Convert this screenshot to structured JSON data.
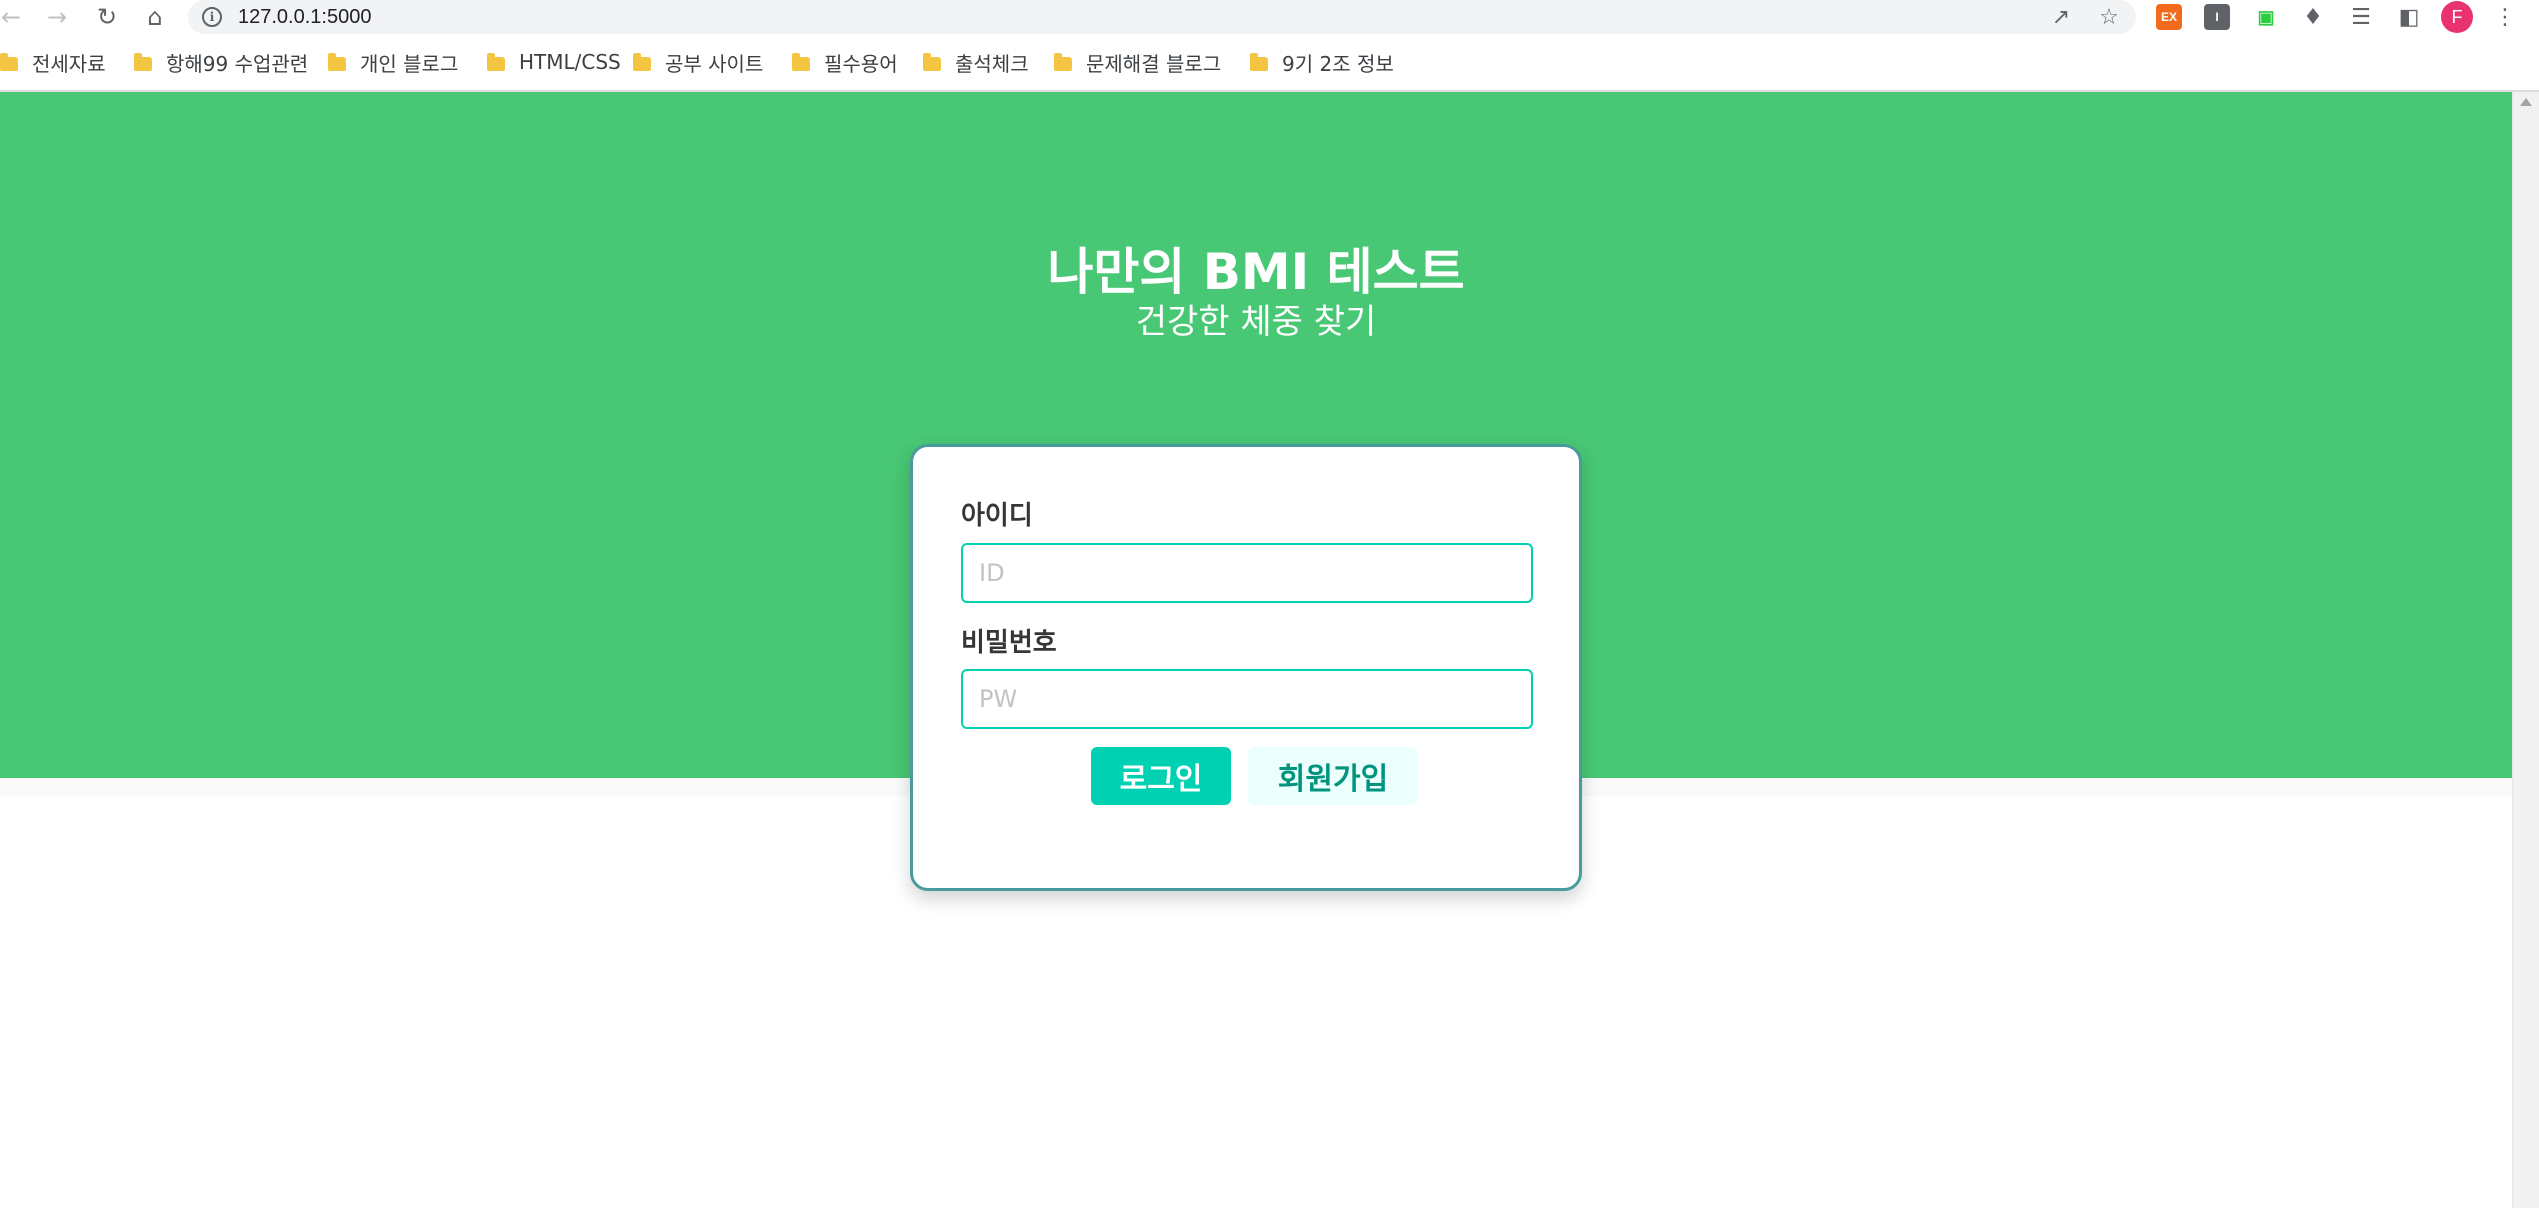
{
  "browser": {
    "url": "127.0.0.1:5000",
    "avatar_letter": "F",
    "extensions": [
      {
        "icon": "ex-extension-icon",
        "text": "EX",
        "color": "#f26b1d"
      },
      {
        "icon": "i-extension-icon",
        "text": "I",
        "color": "#5f6368"
      },
      {
        "icon": "screen-extension-icon",
        "text": "▣",
        "color": "#2ecc40"
      }
    ]
  },
  "bookmarks": [
    {
      "label": "전세자료"
    },
    {
      "label": "항해99 수업관련"
    },
    {
      "label": "개인 블로그"
    },
    {
      "label": "HTML/CSS"
    },
    {
      "label": "공부 사이트"
    },
    {
      "label": "필수용어"
    },
    {
      "label": "출석체크"
    },
    {
      "label": "문제해결 블로그"
    },
    {
      "label": "9기 2조 정보"
    }
  ],
  "hero": {
    "title": "나만의 BMI 테스트",
    "subtitle": "건강한 체중 찾기",
    "color": "#48c774"
  },
  "login": {
    "id_label": "아이디",
    "id_placeholder": "ID",
    "pw_label": "비밀번호",
    "pw_placeholder": "PW",
    "login_button": "로그인",
    "signup_button": "회원가입",
    "accent": "#00d1b2"
  }
}
